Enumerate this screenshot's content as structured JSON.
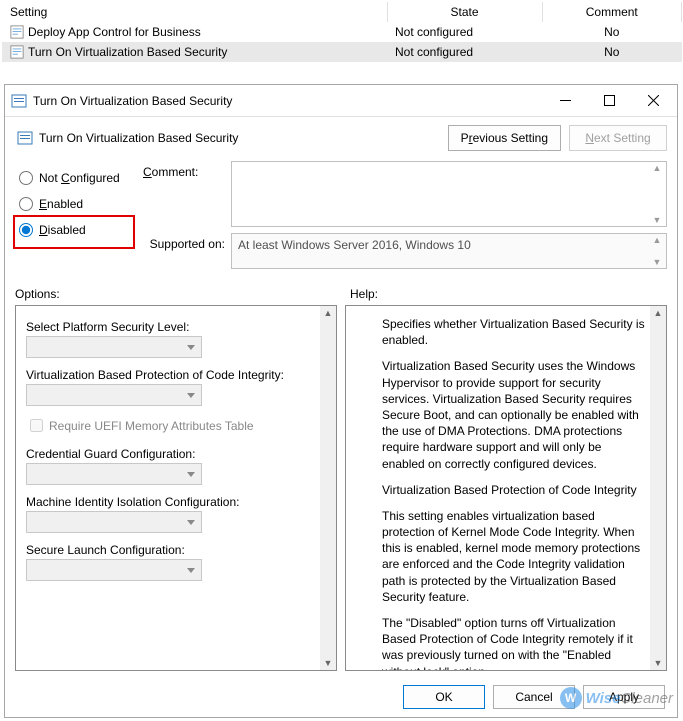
{
  "table": {
    "headers": [
      "Setting",
      "State",
      "Comment"
    ],
    "rows": [
      {
        "setting": "Deploy App Control for Business",
        "state": "Not configured",
        "comment": "No"
      },
      {
        "setting": "Turn On Virtualization Based Security",
        "state": "Not configured",
        "comment": "No"
      }
    ]
  },
  "dialog": {
    "title": "Turn On Virtualization Based Security",
    "header_label": "Turn On Virtualization Based Security",
    "prev_btn_pre": "P",
    "prev_btn_u": "r",
    "prev_btn_post": "evious Setting",
    "next_btn_pre": "",
    "next_btn_u": "N",
    "next_btn_post": "ext Setting",
    "radios": {
      "not_configured_pre": "Not ",
      "not_configured_u": "C",
      "not_configured_post": "onfigured",
      "enabled_u": "E",
      "enabled_post": "nabled",
      "disabled_u": "D",
      "disabled_post": "isabled"
    },
    "comment_u": "C",
    "comment_post": "omment:",
    "supported_label": "Supported on:",
    "supported_value": "At least Windows Server 2016, Windows 10",
    "options_label": "Options:",
    "help_label": "Help:",
    "options": {
      "platform": "Select Platform Security Level:",
      "vbp": "Virtualization Based Protection of Code Integrity:",
      "uefi": "Require UEFI Memory Attributes Table",
      "cred": "Credential Guard Configuration:",
      "machine": "Machine Identity Isolation Configuration:",
      "secure": "Secure Launch Configuration:"
    },
    "help": {
      "p1": "Specifies whether Virtualization Based Security is enabled.",
      "p2": "Virtualization Based Security uses the Windows Hypervisor to provide support for security services. Virtualization Based Security requires Secure Boot, and can optionally be enabled with the use of DMA Protections. DMA protections require hardware support and will only be enabled on correctly configured devices.",
      "p3": "Virtualization Based Protection of Code Integrity",
      "p4": "This setting enables virtualization based protection of Kernel Mode Code Integrity. When this is enabled, kernel mode memory protections are enforced and the Code Integrity validation path is protected by the Virtualization Based Security feature.",
      "p5": "The \"Disabled\" option turns off Virtualization Based Protection of Code Integrity remotely if it was previously turned on with the \"Enabled without lock\" option."
    },
    "footer": {
      "ok": "OK",
      "cancel": "Cancel",
      "apply_u": "A",
      "apply_post": "pply"
    }
  },
  "watermark": {
    "brand1": "Wise",
    "brand2": "Cleaner"
  }
}
